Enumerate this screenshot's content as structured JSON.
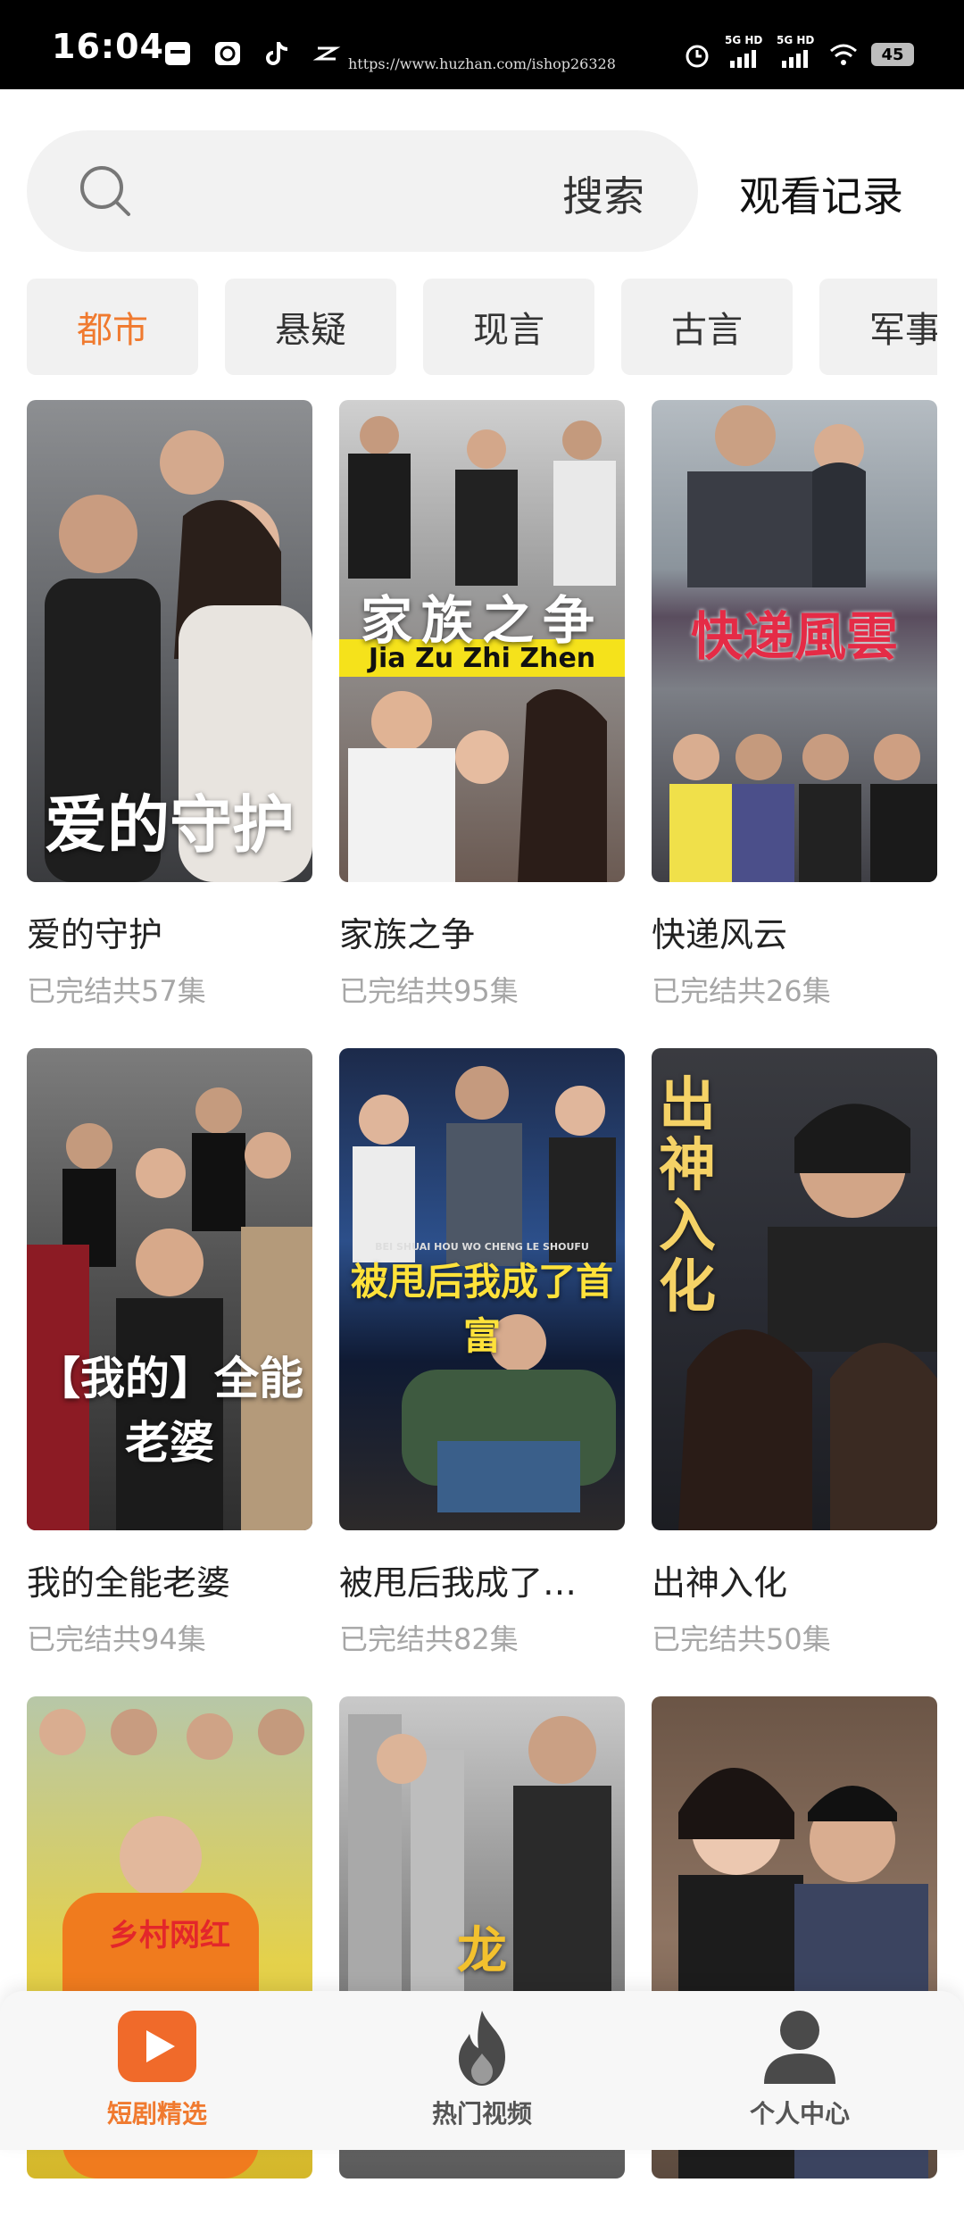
{
  "status_bar": {
    "time": "16:04",
    "url": "https://www.huzhan.com/ishop26328",
    "signal1": "5G HD",
    "signal2": "5G HD",
    "battery": "45"
  },
  "search": {
    "button_label": "搜索",
    "history_label": "观看记录"
  },
  "categories": [
    {
      "label": "都市"
    },
    {
      "label": "悬疑"
    },
    {
      "label": "现言"
    },
    {
      "label": "古言"
    },
    {
      "label": "军事"
    }
  ],
  "dramas": [
    {
      "title": "爱的守护",
      "info": "已完结共57集",
      "poster_text": "爱的守护"
    },
    {
      "title": "家族之争",
      "info": "已完结共95集",
      "poster_text": "家族之争",
      "poster_sub": "Jia Zu Zhi Zhen"
    },
    {
      "title": "快递风云",
      "info": "已完结共26集",
      "poster_text": "快递風雲"
    },
    {
      "title": "我的全能老婆",
      "info": "已完结共94集",
      "poster_text": "【我的】全能老婆"
    },
    {
      "title": "被甩后我成了…",
      "info": "已完结共82集",
      "poster_text": "被甩后我成了首富",
      "poster_sub": "BEI SHUAI HOU WO CHENG LE SHOUFU"
    },
    {
      "title": "出神入化",
      "info": "已完结共50集",
      "poster_text": "出神入化"
    },
    {
      "title": "",
      "info": "",
      "poster_text": "乡村网红"
    },
    {
      "title": "",
      "info": "",
      "poster_text": "龙"
    },
    {
      "title": "",
      "info": "",
      "poster_text": ""
    }
  ],
  "nav": {
    "item1": "短剧精选",
    "item2": "热门视频",
    "item3": "个人中心"
  },
  "colors": {
    "accent": "#f07a2f"
  }
}
